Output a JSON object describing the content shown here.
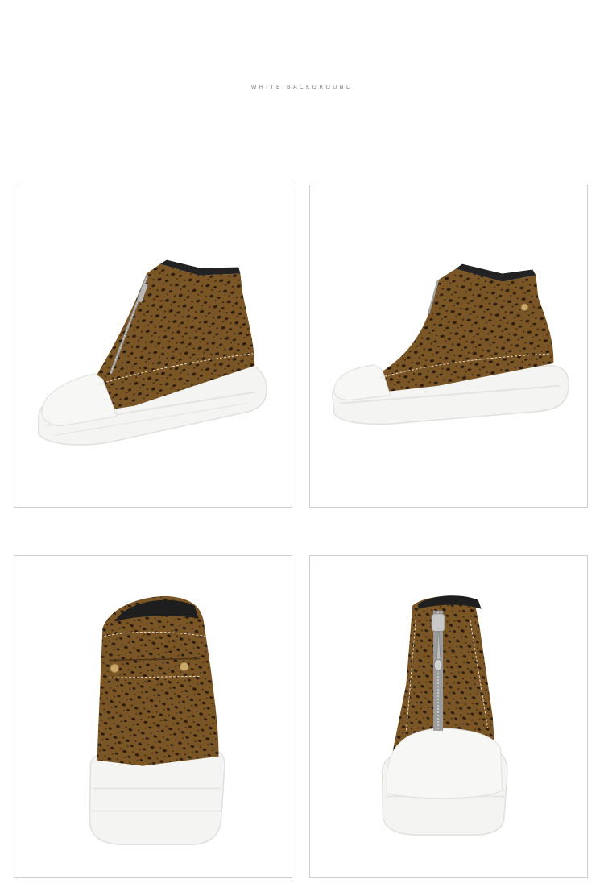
{
  "header": {
    "caption": "WHITE BACKGROUND"
  },
  "gallery": {
    "photos": [
      {
        "view": "side-front-three-quarter"
      },
      {
        "view": "side-profile"
      },
      {
        "view": "back"
      },
      {
        "view": "front"
      }
    ]
  },
  "colors": {
    "suede": "#7a5526",
    "spots": "#2b1d10",
    "sole": "#f5f5f3",
    "frame_border": "#cfcfcf",
    "caption": "#8a8a8a"
  }
}
